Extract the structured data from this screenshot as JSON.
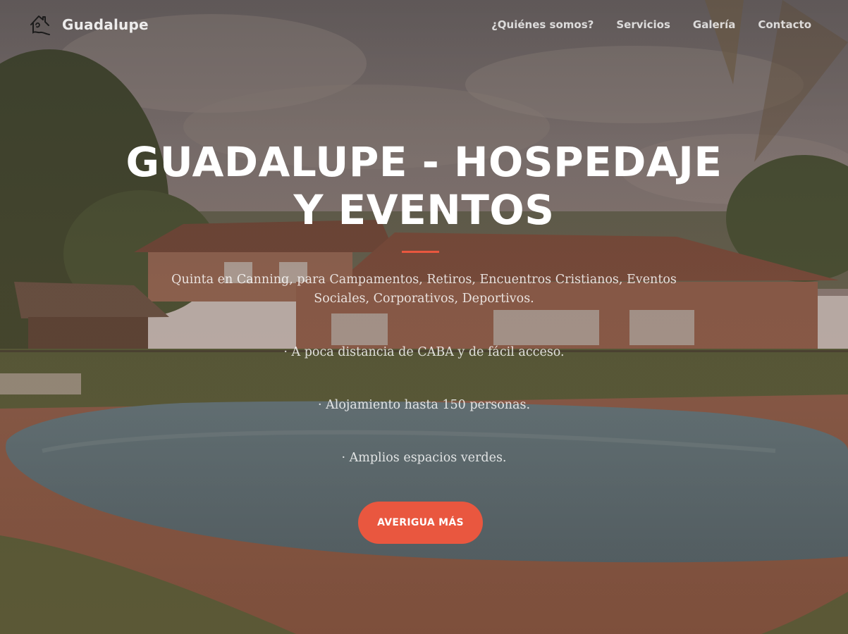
{
  "brand": {
    "name": "Guadalupe",
    "logo_icon": "house-icon"
  },
  "nav": {
    "items": [
      {
        "label": "¿Quiénes somos?"
      },
      {
        "label": "Servicios"
      },
      {
        "label": "Galería"
      },
      {
        "label": "Contacto"
      }
    ]
  },
  "hero": {
    "title": "GUADALUPE - HOSPEDAJE Y EVENTOS",
    "intro": "Quinta en Canning, para Campamentos, Retiros, Encuentros Cristianos, Eventos Sociales, Corporativos, Deportivos.",
    "bullets": [
      "· A poca distancia de CABA y de fácil acceso.",
      "· Alojamiento hasta 150 personas.",
      "· Amplios espacios verdes."
    ],
    "cta_label": "AVERIGUA MÁS"
  },
  "colors": {
    "accent": "#e9573f",
    "text": "#ffffff"
  }
}
